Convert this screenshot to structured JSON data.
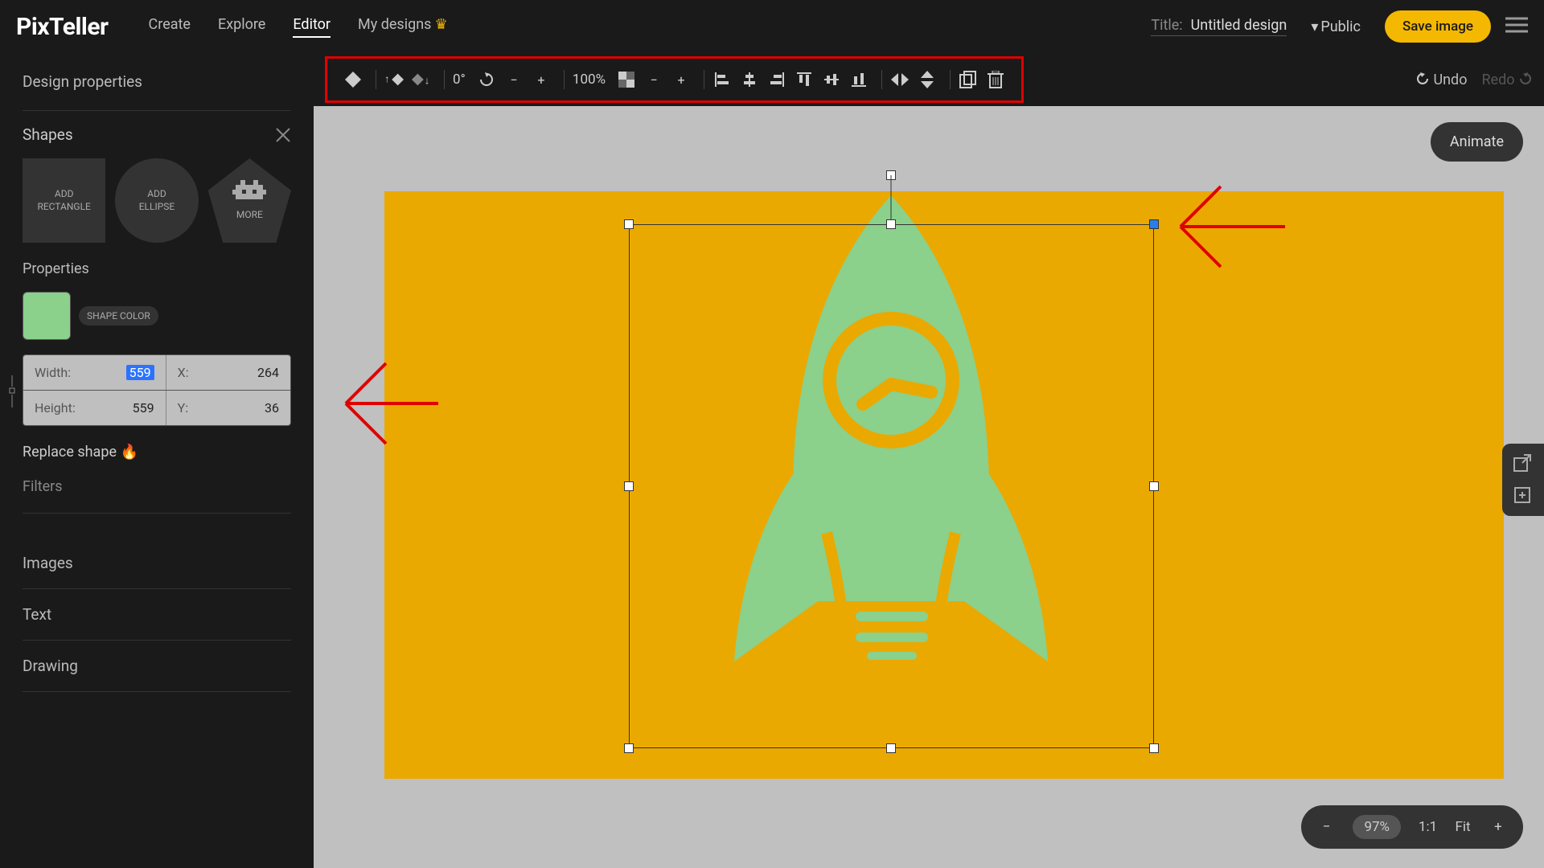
{
  "brand": "PixTeller",
  "nav": {
    "create": "Create",
    "explore": "Explore",
    "editor": "Editor",
    "mydesigns": "My designs"
  },
  "title": {
    "label": "Title:",
    "value": "Untitled design"
  },
  "visibility": "Public",
  "save_btn": "Save image",
  "sidebar": {
    "panel_title": "Design properties",
    "shapes_title": "Shapes",
    "add_rect": "ADD\nRECTANGLE",
    "add_ellipse": "ADD\nELLIPSE",
    "more": "MORE",
    "properties_title": "Properties",
    "shape_color_chip": "SHAPE COLOR",
    "swatch_color": "#8bd08b",
    "width_label": "Width:",
    "width_val": "559",
    "height_label": "Height:",
    "height_val": "559",
    "x_label": "X:",
    "x_val": "264",
    "y_label": "Y:",
    "y_val": "36",
    "replace": "Replace shape 🔥",
    "filters": "Filters",
    "images": "Images",
    "text": "Text",
    "drawing": "Drawing"
  },
  "toolbar": {
    "rotation": "0°",
    "opacity": "100%"
  },
  "undo": "Undo",
  "redo": "Redo",
  "animate": "Animate",
  "zoom": {
    "pct": "97%",
    "oneone": "1:1",
    "fit": "Fit"
  },
  "canvas": {
    "bg": "#eaa900",
    "shape_fill": "#8bd08b"
  }
}
